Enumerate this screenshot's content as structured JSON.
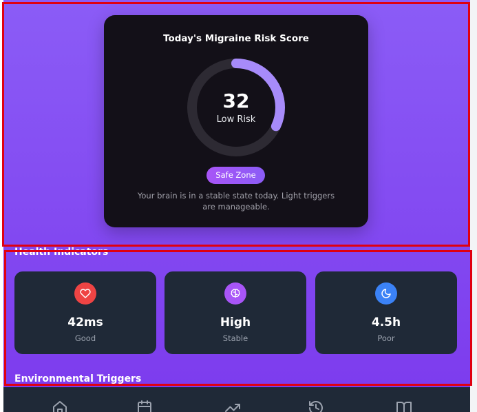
{
  "risk": {
    "title": "Today's Migraine Risk Score",
    "score": "32",
    "score_fraction": 0.32,
    "level": "Low Risk",
    "zone": "Safe Zone",
    "description": "Your brain is in a stable state today. Light triggers are manageable.",
    "gauge_color": "#a78bfa",
    "track_color": "#2d2a33"
  },
  "indicators": {
    "title": "Health Indicators",
    "items": [
      {
        "icon": "heart-icon",
        "value": "42ms",
        "label": "Good",
        "color": "#ef4444"
      },
      {
        "icon": "brain-icon",
        "value": "High",
        "label": "Stable",
        "color": "#a855f7"
      },
      {
        "icon": "moon-icon",
        "value": "4.5h",
        "label": "Poor",
        "color": "#3b82f6"
      }
    ]
  },
  "environment": {
    "title": "Environmental Triggers"
  },
  "nav": {
    "items": [
      {
        "icon": "home-icon"
      },
      {
        "icon": "calendar-icon"
      },
      {
        "icon": "trending-up-icon"
      },
      {
        "icon": "history-icon"
      },
      {
        "icon": "book-icon"
      }
    ]
  }
}
